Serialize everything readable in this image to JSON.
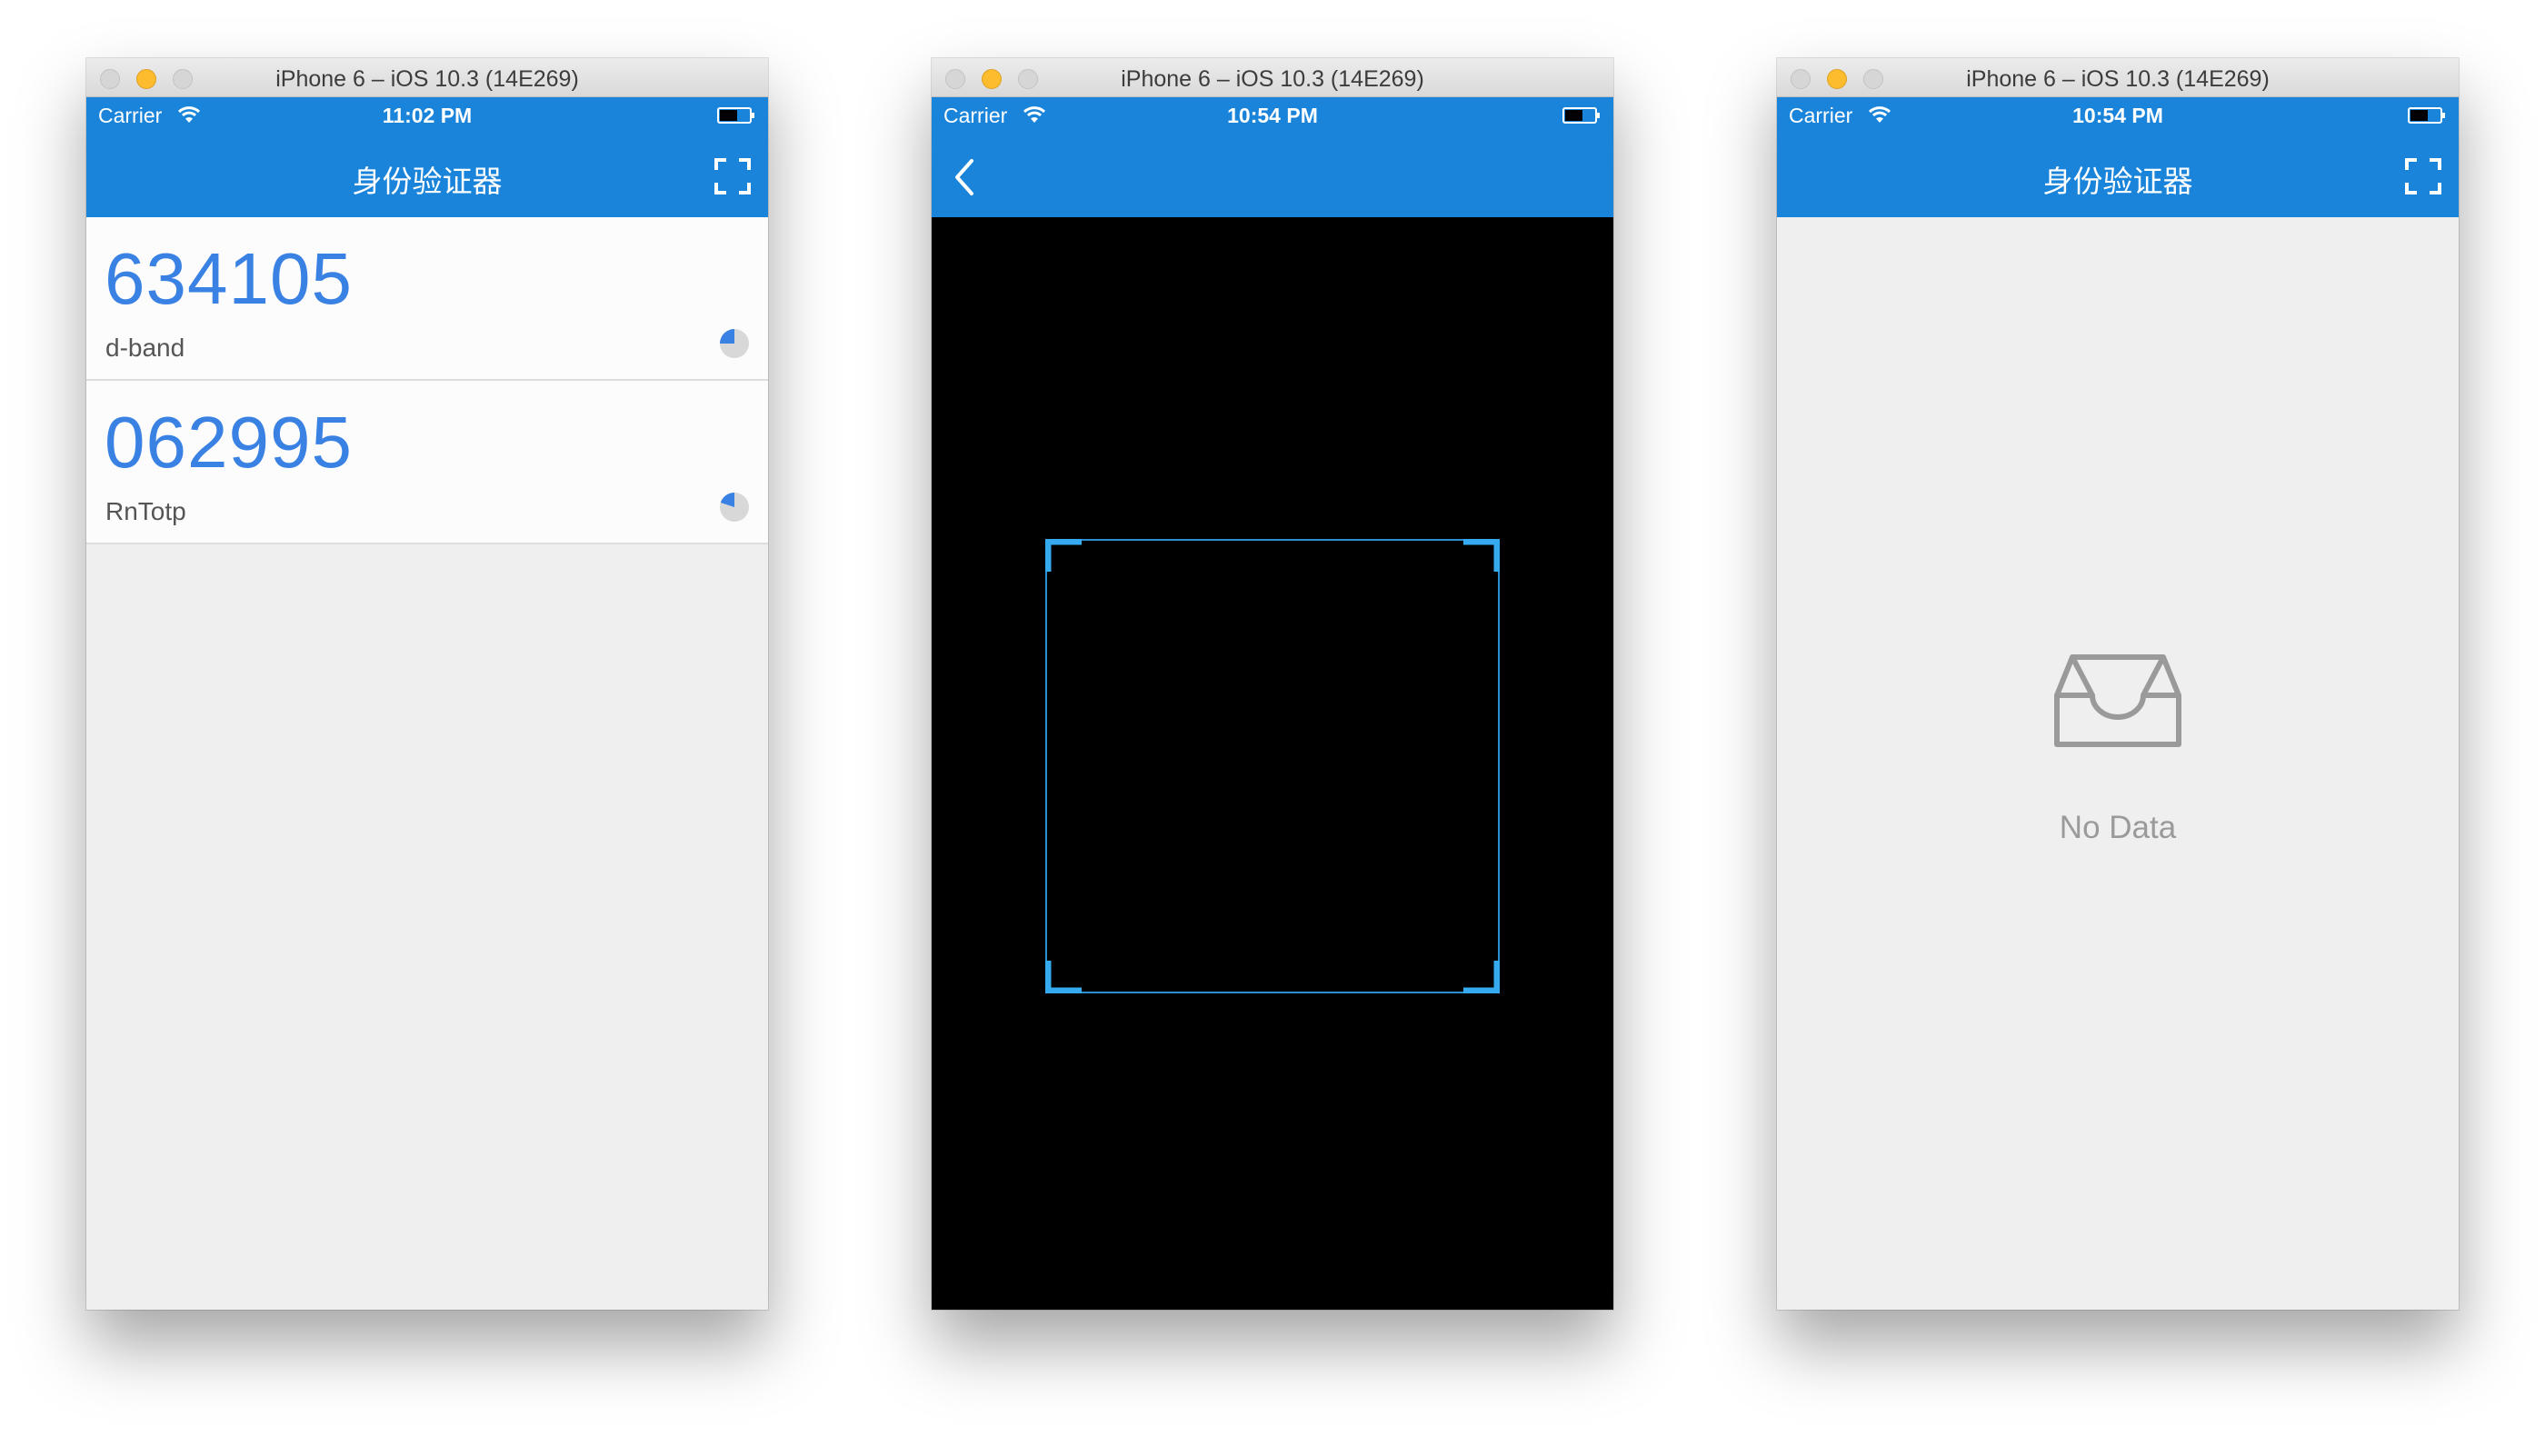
{
  "windows": [
    {
      "title": "iPhone 6 – iOS 10.3 (14E269)",
      "status": {
        "carrier": "Carrier",
        "time": "11:02 PM"
      },
      "nav": {
        "title": "身份验证器",
        "right_icon": "scan-icon"
      },
      "tokens": [
        {
          "code": "634105",
          "name": "d-band",
          "timer_icon": "pie-timer-icon",
          "remaining_fraction": 0.75
        },
        {
          "code": "062995",
          "name": "RnTotp",
          "timer_icon": "pie-timer-icon",
          "remaining_fraction": 0.8
        }
      ]
    },
    {
      "title": "iPhone 6 – iOS 10.3 (14E269)",
      "status": {
        "carrier": "Carrier",
        "time": "10:54 PM"
      },
      "nav": {
        "left_icon": "back-chevron-icon"
      },
      "scanner": {
        "frame_color": "#35aaf0",
        "background": "#000000"
      }
    },
    {
      "title": "iPhone 6 – iOS 10.3 (14E269)",
      "status": {
        "carrier": "Carrier",
        "time": "10:54 PM"
      },
      "nav": {
        "title": "身份验证器",
        "right_icon": "scan-icon"
      },
      "empty": {
        "icon": "inbox-icon",
        "text": "No Data"
      }
    }
  ],
  "colors": {
    "accent": "#1a84da",
    "token_code": "#3a81e4",
    "list_background": "#efefef"
  }
}
